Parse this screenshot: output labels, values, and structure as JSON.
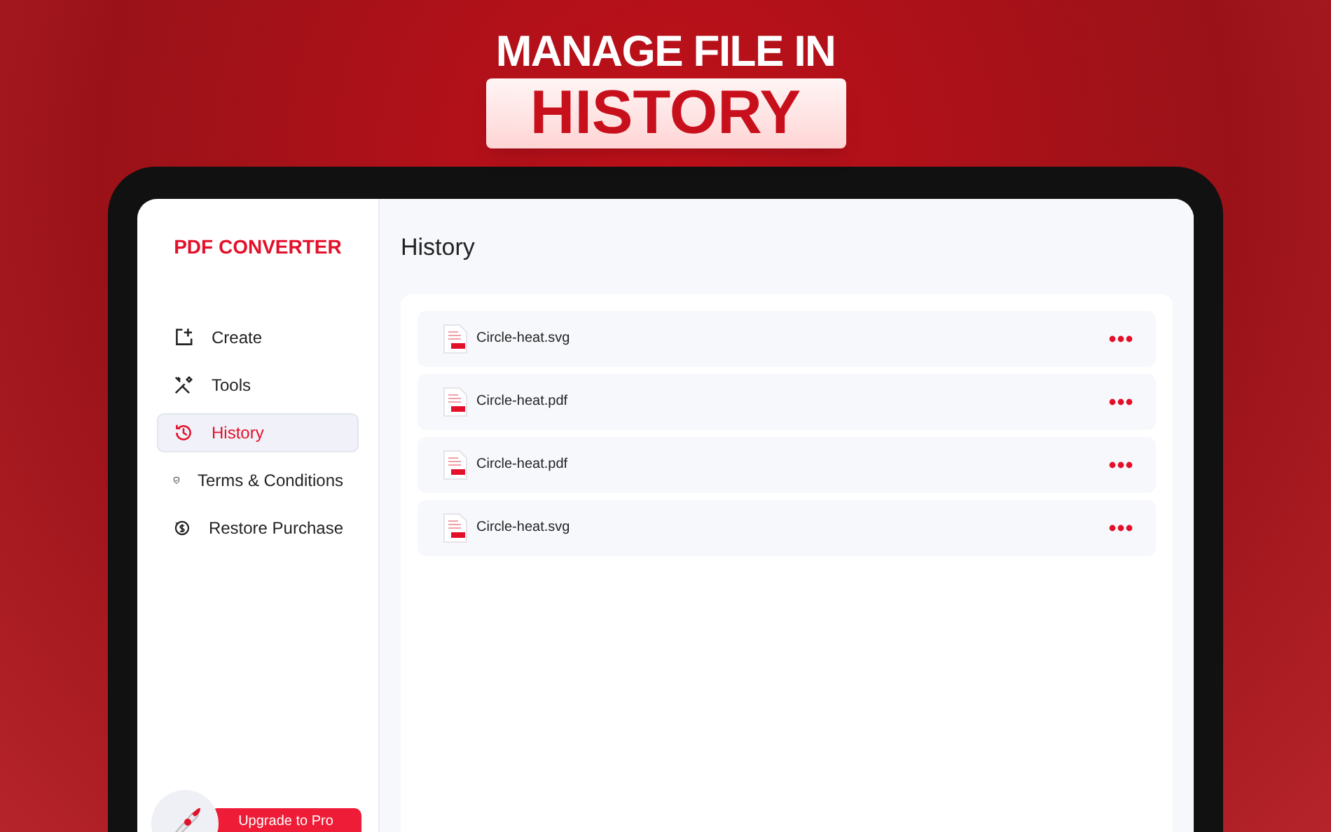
{
  "headline": {
    "line_1": "MANAGE FILE IN",
    "line_2": "HISTORY"
  },
  "sidebar": {
    "app_title": "PDF CONVERTER",
    "items": [
      {
        "label": "Create",
        "kind": "create",
        "selected": false
      },
      {
        "label": "Tools",
        "kind": "tools",
        "selected": false
      },
      {
        "label": "History",
        "kind": "history",
        "selected": true
      },
      {
        "label": "Terms & Conditions",
        "kind": "terms",
        "selected": false
      },
      {
        "label": "Restore Purchase",
        "kind": "restore",
        "selected": false
      }
    ],
    "upgrade_button": "Upgrade to Pro"
  },
  "main": {
    "title": "History",
    "files": [
      {
        "name": "Circle-heat.svg"
      },
      {
        "name": "Circle-heat.pdf"
      },
      {
        "name": "Circle-heat.pdf"
      },
      {
        "name": "Circle-heat.svg"
      }
    ]
  }
}
